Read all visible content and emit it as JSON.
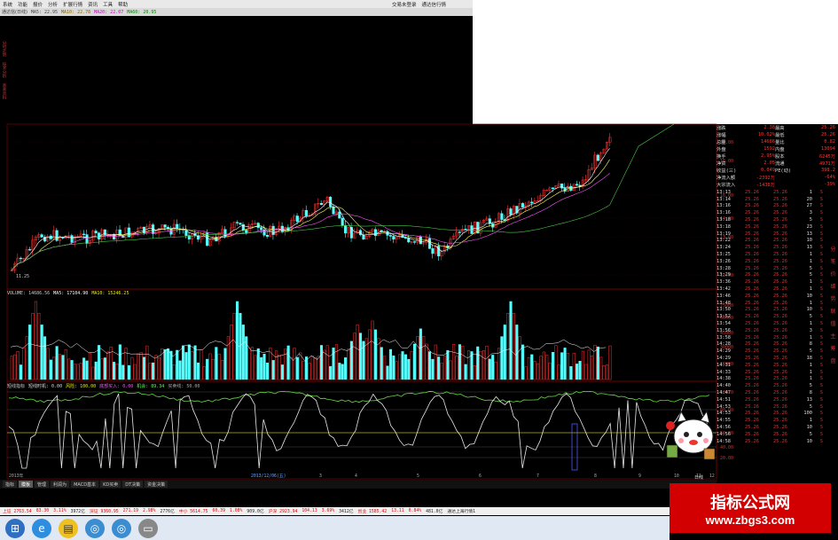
{
  "menu": {
    "items": [
      "系统",
      "功能",
      "报价",
      "分析",
      "扩展行情",
      "资讯",
      "工具",
      "帮助"
    ],
    "right": [
      "交易未登录",
      "通达信行情"
    ]
  },
  "chart_header": {
    "name": "通达信(日线)",
    "ma5": "MA5: 22.95",
    "ma10": "MA10: 22.78",
    "ma20": "MA20: 22.07",
    "ma60": "MA60: 20.95"
  },
  "left_tabs": [
    "分时走势",
    "技术分析",
    "基本资料"
  ],
  "price_axis": [
    "19.00",
    "18.00",
    "16.00",
    "14.00",
    "13.00",
    "12.00"
  ],
  "low_marker": "11.25",
  "volume_header": {
    "label": "VOLUME: 14686.56",
    "ma5": "MA5: 17104.90",
    "ma10": "MA10: 15246.25"
  },
  "volume_axis": [
    "75000",
    "60000",
    "45000",
    "30000",
    "15000"
  ],
  "indicator_header": {
    "items": [
      "短线指标",
      "短线时机: 0.00",
      "风险: 100.00",
      "底部买入: 0.00",
      "机会: 89.34",
      "买卖线: 50.00"
    ]
  },
  "indicator_axis": [
    "100.0",
    "80.00",
    "50.00",
    "40.00",
    "20.00"
  ],
  "date_markers": [
    "2013年",
    "2013/12/06(五)",
    "3",
    "4",
    "5",
    "6",
    "7",
    "8",
    "9",
    "10",
    "11",
    "12"
  ],
  "quote": {
    "rows": [
      {
        "k1": "涨跌",
        "v1": "2.38",
        "k2": "最高",
        "v2": "25.26"
      },
      {
        "k1": "涨幅",
        "v1": "10.02%",
        "k2": "最低",
        "v2": "25.26"
      },
      {
        "k1": "总量",
        "v1": "14686",
        "k2": "量比",
        "v2": "0.82"
      },
      {
        "k1": "外盘",
        "v1": "1592",
        "k2": "内盘",
        "v2": "13094"
      },
      {
        "k1": "换手",
        "v1": "2.95%",
        "k2": "股本",
        "v2": "6245万"
      },
      {
        "k1": "净资",
        "v1": "2.05",
        "k2": "流通",
        "v2": "4971万"
      },
      {
        "k1": "收益(三)",
        "v1": "0.049",
        "k2": "PE(动)",
        "v2": "398.2"
      },
      {
        "k1": "净流入额",
        "v1": "-2392万",
        "k2": "",
        "v2": "-64%"
      },
      {
        "k1": "大宗流入",
        "v1": "-1438万",
        "k2": "",
        "v2": "-39%"
      }
    ],
    "ticks": [
      {
        "time": "13:13",
        "price": "25.26",
        "p2": "25.26",
        "vol": "1",
        "side": "S"
      },
      {
        "time": "13:14",
        "price": "25.26",
        "p2": "25.26",
        "vol": "20",
        "side": "S"
      },
      {
        "time": "13:16",
        "price": "25.26",
        "p2": "25.26",
        "vol": "27",
        "side": "S"
      },
      {
        "time": "13:16",
        "price": "25.26",
        "p2": "25.26",
        "vol": "3",
        "side": "S"
      },
      {
        "time": "13:18",
        "price": "25.26",
        "p2": "25.26",
        "vol": "5",
        "side": "S"
      },
      {
        "time": "13:18",
        "price": "25.26",
        "p2": "25.26",
        "vol": "23",
        "side": "S"
      },
      {
        "time": "13:19",
        "price": "25.26",
        "p2": "25.26",
        "vol": "13",
        "side": "S"
      },
      {
        "time": "13:22",
        "price": "25.26",
        "p2": "25.26",
        "vol": "10",
        "side": "S"
      },
      {
        "time": "13:24",
        "price": "25.26",
        "p2": "25.26",
        "vol": "13",
        "side": "S"
      },
      {
        "time": "13:25",
        "price": "25.26",
        "p2": "25.26",
        "vol": "1",
        "side": "S"
      },
      {
        "time": "13:26",
        "price": "25.26",
        "p2": "25.26",
        "vol": "1",
        "side": "S"
      },
      {
        "time": "13:28",
        "price": "25.26",
        "p2": "25.26",
        "vol": "5",
        "side": "S"
      },
      {
        "time": "13:29",
        "price": "25.26",
        "p2": "25.26",
        "vol": "5",
        "side": "S"
      },
      {
        "time": "13:36",
        "price": "25.26",
        "p2": "25.26",
        "vol": "1",
        "side": "S"
      },
      {
        "time": "13:42",
        "price": "25.26",
        "p2": "25.26",
        "vol": "1",
        "side": "S"
      },
      {
        "time": "13:46",
        "price": "25.26",
        "p2": "25.26",
        "vol": "10",
        "side": "S"
      },
      {
        "time": "13:48",
        "price": "25.26",
        "p2": "25.26",
        "vol": "1",
        "side": "S"
      },
      {
        "time": "13:50",
        "price": "25.26",
        "p2": "25.26",
        "vol": "10",
        "side": "S"
      },
      {
        "time": "13:52",
        "price": "25.26",
        "p2": "25.26",
        "vol": "5",
        "side": "S"
      },
      {
        "time": "13:54",
        "price": "25.26",
        "p2": "25.26",
        "vol": "1",
        "side": "S"
      },
      {
        "time": "13:56",
        "price": "25.26",
        "p2": "25.26",
        "vol": "3",
        "side": "S"
      },
      {
        "time": "13:58",
        "price": "25.26",
        "p2": "25.26",
        "vol": "1",
        "side": "S"
      },
      {
        "time": "14:28",
        "price": "25.26",
        "p2": "25.26",
        "vol": "8",
        "side": "S"
      },
      {
        "time": "14:29",
        "price": "25.26",
        "p2": "25.26",
        "vol": "5",
        "side": "S"
      },
      {
        "time": "14:29",
        "price": "25.26",
        "p2": "25.26",
        "vol": "18",
        "side": "S"
      },
      {
        "time": "14:31",
        "price": "25.26",
        "p2": "25.26",
        "vol": "1",
        "side": "S"
      },
      {
        "time": "14:33",
        "price": "25.26",
        "p2": "25.26",
        "vol": "1",
        "side": "S"
      },
      {
        "time": "14:38",
        "price": "25.26",
        "p2": "25.26",
        "vol": "1",
        "side": "S"
      },
      {
        "time": "14:40",
        "price": "25.26",
        "p2": "25.26",
        "vol": "5",
        "side": "S"
      },
      {
        "time": "14:47",
        "price": "25.26",
        "p2": "25.26",
        "vol": "8",
        "side": "S"
      },
      {
        "time": "14:51",
        "price": "25.26",
        "p2": "25.26",
        "vol": "13",
        "side": "S"
      },
      {
        "time": "14:53",
        "price": "25.26",
        "p2": "25.26",
        "vol": "5",
        "side": "S"
      },
      {
        "time": "14:53",
        "price": "25.26",
        "p2": "25.26",
        "vol": "100",
        "side": "S"
      },
      {
        "time": "14:55",
        "price": "25.26",
        "p2": "25.26",
        "vol": "1",
        "side": "S"
      },
      {
        "time": "14:56",
        "price": "25.26",
        "p2": "25.26",
        "vol": "10",
        "side": "S"
      },
      {
        "time": "14:56",
        "price": "25.26",
        "p2": "25.26",
        "vol": "5",
        "side": "S"
      },
      {
        "time": "14:58",
        "price": "25.26",
        "p2": "25.26",
        "vol": "10",
        "side": "S"
      }
    ]
  },
  "right_icons": [
    "分",
    "笔",
    "价",
    "细",
    "势",
    "联",
    "值",
    "主",
    "筹",
    "盘"
  ],
  "bottom_tabs": [
    {
      "label": "指标",
      "active": false
    },
    {
      "label": "模板",
      "active": true
    },
    {
      "label": "管理",
      "active": false
    },
    {
      "label": "利润为",
      "active": false
    },
    {
      "label": "MACD基本",
      "active": false
    },
    {
      "label": "KD买卖",
      "active": false
    },
    {
      "label": "DT决策",
      "active": false
    },
    {
      "label": "资金决策",
      "active": false
    }
  ],
  "status": {
    "items": [
      {
        "text": "上证 2763.54",
        "up": true
      },
      {
        "text": "83.30",
        "up": true
      },
      {
        "text": "3.11%",
        "up": true
      },
      {
        "text": "3972亿",
        "up": false
      },
      {
        "text": "深证 9360.95",
        "up": true
      },
      {
        "text": "271.19",
        "up": true
      },
      {
        "text": "2.98%",
        "up": true
      },
      {
        "text": "2776亿",
        "up": false
      },
      {
        "text": "中小 5614.75",
        "up": true
      },
      {
        "text": "60.39",
        "up": true
      },
      {
        "text": "1.08%",
        "up": true
      },
      {
        "text": "909.0亿",
        "up": false
      },
      {
        "text": "沪深 2923.94",
        "up": true
      },
      {
        "text": "104.13",
        "up": true
      },
      {
        "text": "3.69%",
        "up": true
      },
      {
        "text": "3412亿",
        "up": false
      },
      {
        "text": "创业 1585.42",
        "up": true
      },
      {
        "text": "13.11",
        "up": true
      },
      {
        "text": "0.84%",
        "up": true
      },
      {
        "text": "481.0亿",
        "up": false
      },
      {
        "text": "通达上海行情1",
        "up": false
      }
    ]
  },
  "watermark": {
    "line1": "指标公式网",
    "line2": "www.zbgs3.com"
  },
  "colors": {
    "up": "#ff3030",
    "down": "#54ffff",
    "ma5": "#ffffff",
    "ma10": "#ffff55",
    "ma20": "#ff55ff",
    "ma60": "#44cc44",
    "grid": "#7a0000"
  }
}
